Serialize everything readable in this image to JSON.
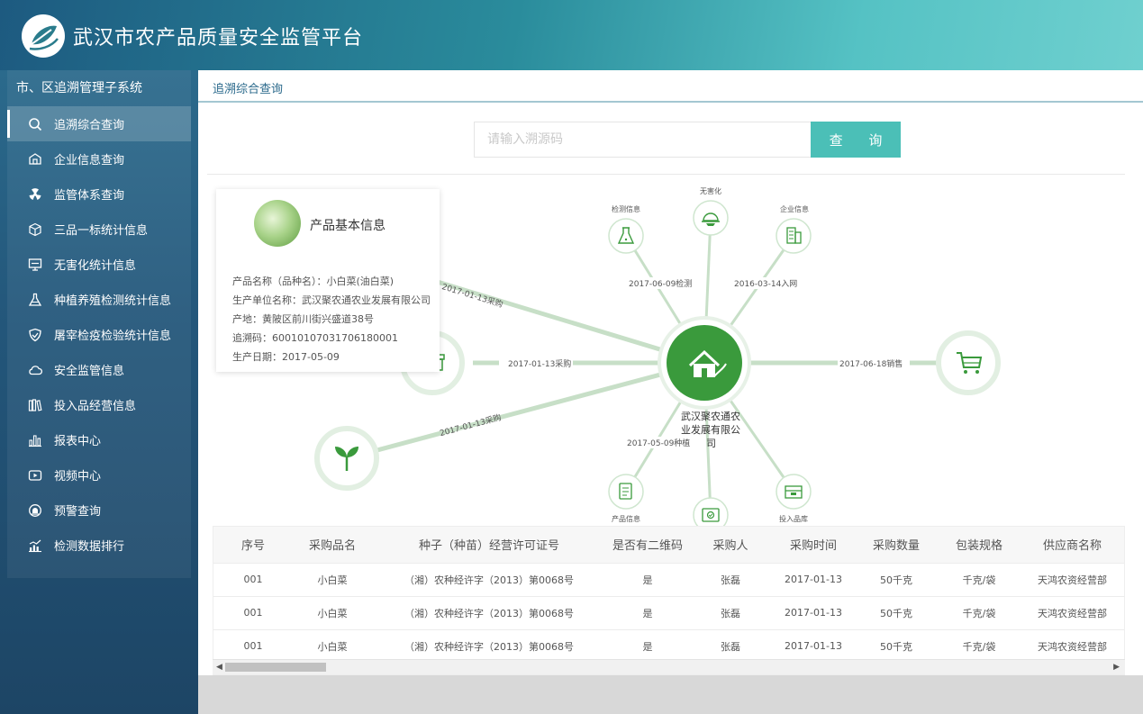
{
  "app": {
    "title": "武汉市农产品质量安全监管平台"
  },
  "sidebar": {
    "subsystem_title": "市、区追溯管理子系统",
    "items": [
      {
        "label": "追溯综合查询",
        "icon": "search-icon",
        "active": true
      },
      {
        "label": "企业信息查询",
        "icon": "enterprise-icon"
      },
      {
        "label": "监管体系查询",
        "icon": "radiation-icon"
      },
      {
        "label": "三品一标统计信息",
        "icon": "cube-icon"
      },
      {
        "label": "无害化统计信息",
        "icon": "monitor-icon"
      },
      {
        "label": "种植养殖检测统计信息",
        "icon": "flask-icon"
      },
      {
        "label": "屠宰检疫检验统计信息",
        "icon": "shield-icon"
      },
      {
        "label": "安全监管信息",
        "icon": "cloud-icon"
      },
      {
        "label": "投入品经营信息",
        "icon": "books-icon"
      },
      {
        "label": "报表中心",
        "icon": "bar-chart-icon"
      },
      {
        "label": "视频中心",
        "icon": "video-icon"
      },
      {
        "label": "预警查询",
        "icon": "alert-icon"
      },
      {
        "label": "检测数据排行",
        "icon": "ranking-icon"
      }
    ]
  },
  "main": {
    "breadcrumb": "追溯综合查询",
    "search": {
      "placeholder": "请输入溯源码",
      "button_label": "查 询"
    }
  },
  "product_info": {
    "title": "产品基本信息",
    "lines": [
      "产品名称（品种名）：小白菜(油白菜)",
      "生产单位名称：武汉聚农通农业发展有限公司",
      "产地：黄陂区前川街兴盛道38号",
      "追溯码：60010107031706180001",
      "生产日期：2017-05-09"
    ]
  },
  "graph": {
    "center_label_lines": [
      "武汉聚农通农",
      "业发展有限公",
      "司"
    ],
    "edge_labels": {
      "purchase_top": "2017-01-13采购",
      "purchase_mid": "2017-01-13采购",
      "purchase_bottom": "2017-01-13采购",
      "sale": "2017-06-18销售",
      "inspection": "2017-06-09检测",
      "network": "2016-03-14入网",
      "planting": "2017-05-09种植"
    },
    "node_labels": {
      "inspection": "检测信息",
      "harmless": "无害化",
      "enterprise": "企业信息",
      "product": "产品信息",
      "inputs": "投入品库"
    },
    "node_icons": [
      "flask-icon",
      "helmet-icon",
      "building-icon",
      "cart-icon",
      "house-icon",
      "seedling-icon",
      "document-icon",
      "certificate-icon",
      "box-icon",
      "gift-icon"
    ]
  },
  "table": {
    "headers": [
      "序号",
      "采购品名",
      "种子（种苗）经营许可证号",
      "是否有二维码",
      "采购人",
      "采购时间",
      "采购数量",
      "包装规格",
      "供应商名称"
    ],
    "rows": [
      [
        "001",
        "小白菜",
        "（湘）农种经许字（2013）第0068号",
        "是",
        "张磊",
        "2017-01-13",
        "50千克",
        "千克/袋",
        "天鸿农资经营部"
      ],
      [
        "001",
        "小白菜",
        "（湘）农种经许字（2013）第0068号",
        "是",
        "张磊",
        "2017-01-13",
        "50千克",
        "千克/袋",
        "天鸿农资经营部"
      ],
      [
        "001",
        "小白菜",
        "（湘）农种经许字（2013）第0068号",
        "是",
        "张磊",
        "2017-01-13",
        "50千克",
        "千克/袋",
        "天鸿农资经营部"
      ]
    ]
  },
  "colors": {
    "accent": "#4bbfb7",
    "brand_green": "#3a9a3c",
    "sidebar": "#23567a"
  }
}
